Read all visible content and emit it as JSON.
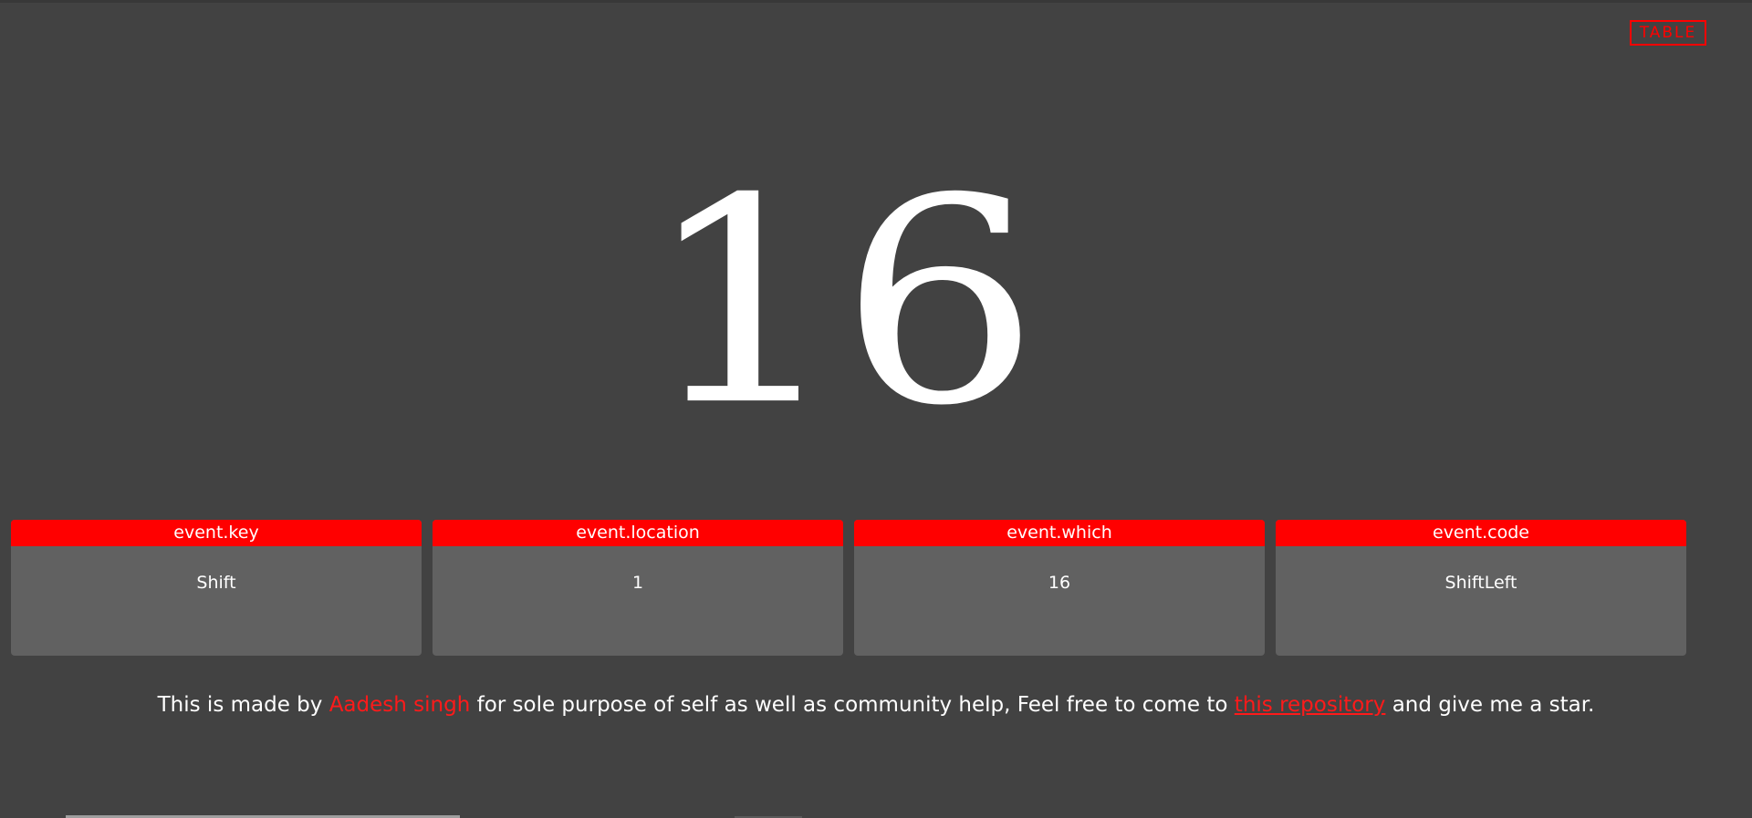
{
  "table_button": {
    "label": "TABLE"
  },
  "key_display": {
    "value": "16"
  },
  "cards": [
    {
      "label": "event.key",
      "value": "Shift"
    },
    {
      "label": "event.location",
      "value": "1"
    },
    {
      "label": "event.which",
      "value": "16"
    },
    {
      "label": "event.code",
      "value": "ShiftLeft"
    }
  ],
  "footer": {
    "prefix": "This is made by",
    "author": "Aadesh singh",
    "middle": "for sole purpose of self as well as community help, Feel free to come to",
    "link_text": "this repository",
    "suffix": "and give me a star."
  },
  "colors": {
    "background": "#424242",
    "accent": "#ff0000",
    "card": "#616161"
  }
}
